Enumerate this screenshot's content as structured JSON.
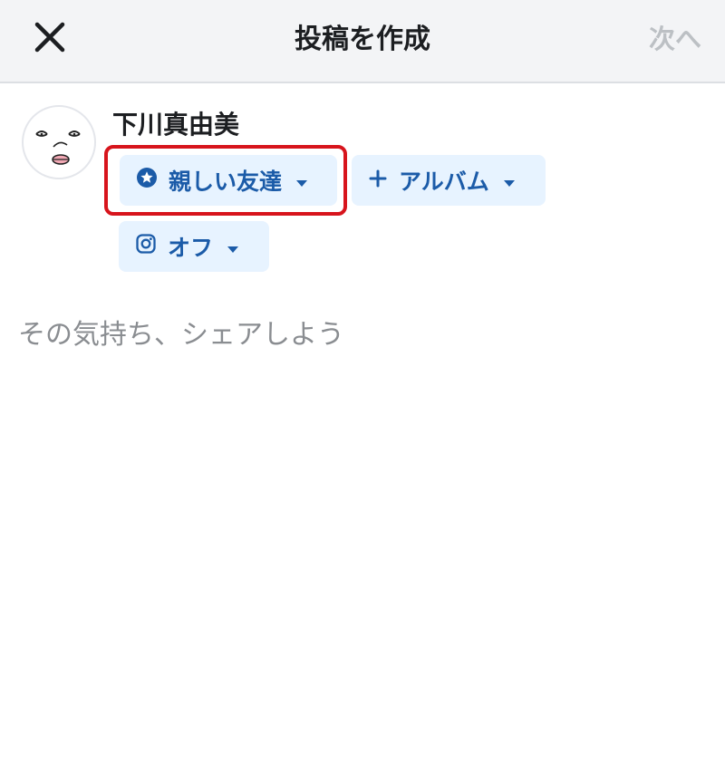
{
  "header": {
    "title": "投稿を作成",
    "next_label": "次へ"
  },
  "user": {
    "name": "下川真由美"
  },
  "audience": {
    "label": "親しい友達",
    "icon": "star-circle-icon"
  },
  "album": {
    "label": "アルバム",
    "icon": "plus-icon"
  },
  "instagram": {
    "label": "オフ",
    "icon": "instagram-icon"
  },
  "composer": {
    "placeholder": "その気持ち、シェアしよう"
  },
  "colors": {
    "accent": "#1b5ba8",
    "pill_bg": "#e7f3ff",
    "highlight": "#d7141c",
    "disabled": "#bcc0c4"
  }
}
